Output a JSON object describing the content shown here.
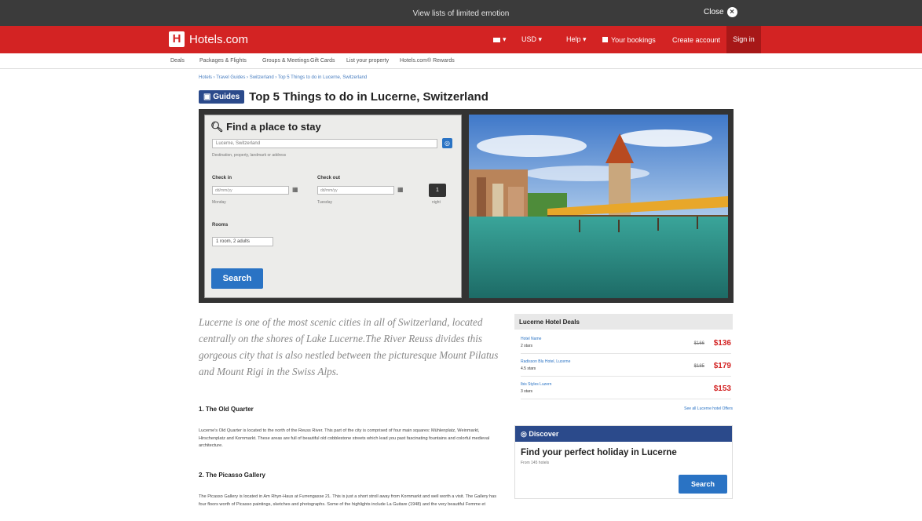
{
  "topbar": {
    "message": "View lists of limited emotion",
    "close_label": "Close"
  },
  "header": {
    "logo": "Hotels.com",
    "flag_menu": "▾",
    "currency": "USD ▾",
    "help": "Help ▾",
    "bookings": "Your bookings",
    "create_account": "Create account",
    "sign_in": "Sign in"
  },
  "subnav": [
    "Deals",
    "Packages & Flights",
    "Groups & Meetings",
    "Gift Cards",
    "List your property",
    "Hotels.com® Rewards"
  ],
  "breadcrumb": "Hotels › Travel Guides › Switzerland › Top 5 Things to do in Lucerne, Switzerland",
  "guide": {
    "badge": "Guides",
    "title": "Top 5 Things to do in Lucerne, Switzerland"
  },
  "search": {
    "title": "Find a place to stay",
    "destination": "Lucerne, Switzerland",
    "hint": "Destination, property, landmark or address",
    "checkin_label": "Check in",
    "checkout_label": "Check out",
    "checkin_value": "dd/mm/yy",
    "checkout_value": "dd/mm/yy",
    "checkin_day": "Monday",
    "checkout_day": "Tuesday",
    "nights": "1",
    "nights_label": "night",
    "rooms_label": "Rooms",
    "rooms_value": "1 room, 2 adults",
    "button": "Search"
  },
  "article": {
    "intro": "Lucerne is one of the most scenic cities in all of Switzerland, located centrally on the shores of Lake Lucerne.The River Reuss divides this gorgeous city that is also nestled between the picturesque Mount Pilatus and Mount Rigi in the Swiss Alps.",
    "s1_title": "1. The Old Quarter",
    "s1_text": "Lucerne's Old Quarter is located to the north of the Reuss River. This part of the city is comprised of four main squares: Mühlenplatz, Weinmarkt, Hirschenplatz and Kornmarkt. These areas are full of beautiful old cobblestone streets which lead you past fascinating fountains and colorful medieval architecture.",
    "s2_title": "2. The Picasso Gallery",
    "s2_text": "The Picasso Gallery is located in Am Rhyn-Haus at Furrengasse 21. This is just a short stroll away from Kornmarkt and well worth a visit. The Gallery has four floors worth of Picasso paintings, sketches and photographs. Some of the highlights include La Guitare (1948) and the very beautiful Femme et"
  },
  "deals": {
    "title": "Lucerne Hotel Deals",
    "items": [
      {
        "name": "Hotel Name",
        "stars": "2 stars",
        "old": "$166",
        "price": "$136"
      },
      {
        "name": "Radisson Blu Hotel, Lucerne",
        "stars": "4.5 stars",
        "old": "$185",
        "price": "$179"
      },
      {
        "name": "Ibis Styles Luzern",
        "stars": "3 stars",
        "old": "",
        "price": "$153"
      }
    ],
    "see_all": "See all Lucerne hotel Offers"
  },
  "discover": {
    "title": "Discover",
    "heading": "Find your perfect holiday in Lucerne",
    "sub": "From 145 hotels",
    "button": "Search"
  }
}
